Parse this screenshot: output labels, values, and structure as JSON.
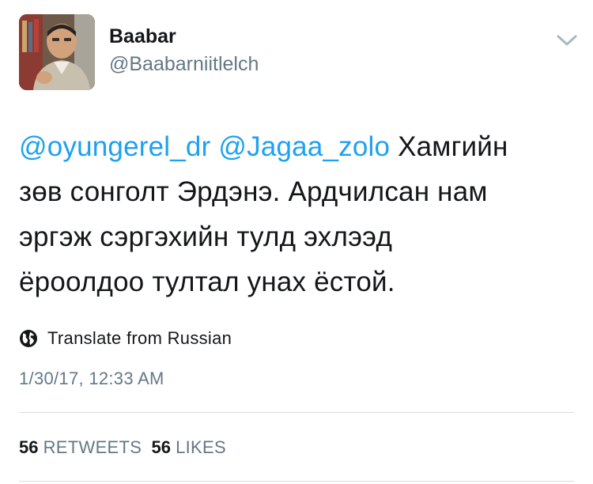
{
  "author": {
    "display_name": "Baabar",
    "handle": "@Baabarniitlelch"
  },
  "tweet": {
    "mention_1": "@oyungerel_dr",
    "mention_2": "@Jagaa_zolo",
    "line1_rest": "Хамгийн",
    "line2": "зөв сонголт Эрдэнэ. Ардчилсан нам",
    "line3": "эргэж сэргэхийн тулд эхлээд",
    "line4": "ёроолдоо тултал унах ёстой."
  },
  "translate": {
    "icon": "globe-icon",
    "label": "Translate from Russian"
  },
  "timestamp": "1/30/17, 12:33 AM",
  "stats": {
    "retweets_count": "56",
    "retweets_label": "RETWEETS",
    "likes_count": "56",
    "likes_label": "LIKES"
  },
  "colors": {
    "link": "#1da1f2",
    "secondary_text": "#657786",
    "primary_text": "#14171a",
    "divider": "#d8dee3"
  }
}
